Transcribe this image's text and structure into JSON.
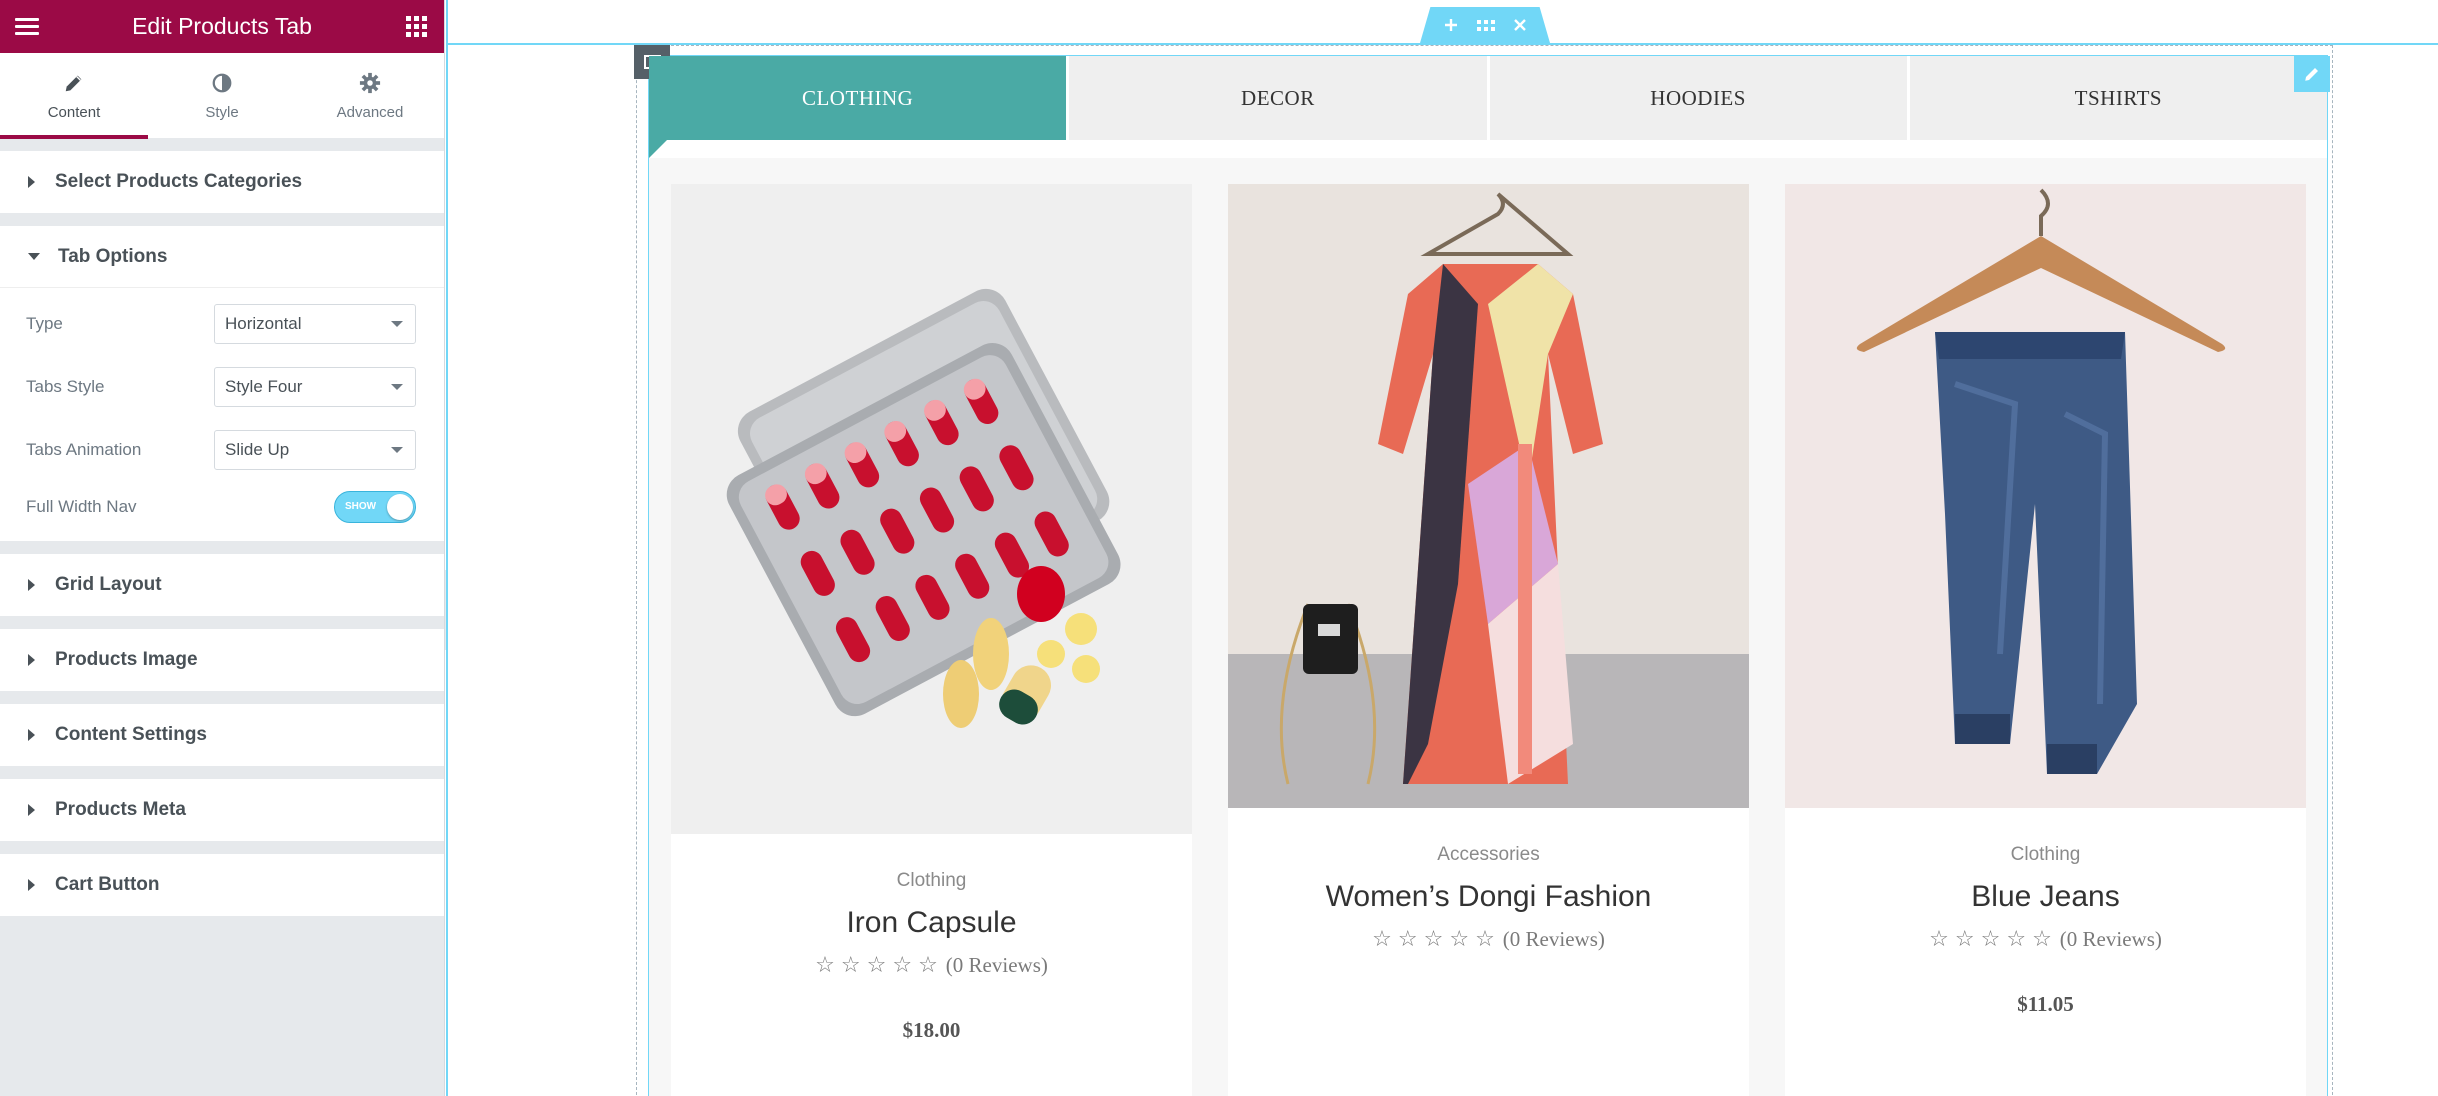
{
  "panel": {
    "title": "Edit Products Tab",
    "header_icons": {
      "menu": "hamburger-icon",
      "apps": "grid-icon"
    },
    "tabs": [
      {
        "label": "Content",
        "icon": "pencil-icon",
        "active": true
      },
      {
        "label": "Style",
        "icon": "half-circle-icon",
        "active": false
      },
      {
        "label": "Advanced",
        "icon": "gear-icon",
        "active": false
      }
    ],
    "sections": {
      "select_categories": "Select Products Categories",
      "tab_options": "Tab Options",
      "grid_layout": "Grid Layout",
      "products_image": "Products Image",
      "content_settings": "Content Settings",
      "products_meta": "Products Meta",
      "cart_button": "Cart Button"
    },
    "controls": {
      "type": {
        "label": "Type",
        "value": "Horizontal"
      },
      "tabs_style": {
        "label": "Tabs Style",
        "value": "Style Four"
      },
      "tabs_animation": {
        "label": "Tabs Animation",
        "value": "Slide Up"
      },
      "full_width_nav": {
        "label": "Full Width Nav",
        "toggle_text": "SHOW",
        "on": true
      }
    },
    "accent_color": "#9b0a46"
  },
  "editor": {
    "accent_color": "#71d7f7",
    "handle_icons": [
      "plus-icon",
      "drag-icon",
      "close-icon"
    ]
  },
  "product_tabs": {
    "active_color": "#4aaaa5",
    "items": [
      {
        "label": "CLOTHING",
        "active": true
      },
      {
        "label": "DECOR",
        "active": false
      },
      {
        "label": "HOODIES",
        "active": false
      },
      {
        "label": "TSHIRTS",
        "active": false
      }
    ]
  },
  "products": [
    {
      "category": "Clothing",
      "name": "Iron Capsule",
      "reviews": "(0 Reviews)",
      "price": "$18.00",
      "image": "capsule-pills-image"
    },
    {
      "category": "Accessories",
      "name": "Women’s Dongi Fashion",
      "reviews": "(0 Reviews)",
      "price": "",
      "image": "dress-on-hanger-image"
    },
    {
      "category": "Clothing",
      "name": "Blue Jeans",
      "reviews": "(0 Reviews)",
      "price": "$11.05",
      "image": "jeans-on-hanger-image"
    }
  ]
}
